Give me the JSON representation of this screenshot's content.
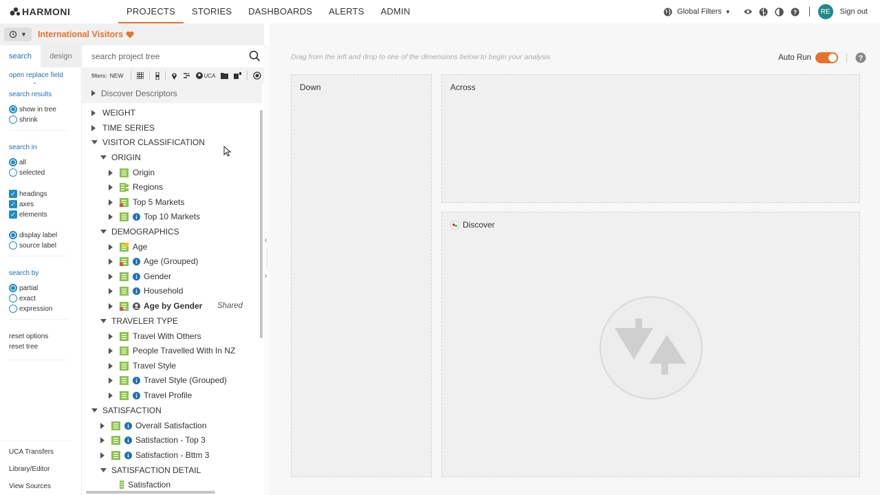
{
  "app": {
    "name": "HARMONI"
  },
  "nav": [
    "PROJECTS",
    "STORIES",
    "DASHBOARDS",
    "ALERTS",
    "ADMIN"
  ],
  "topright": {
    "global_filters": "Global Filters",
    "avatar": "RE",
    "signout": "Sign out"
  },
  "project": {
    "title": "International Visitors"
  },
  "options": {
    "tab_search": "search",
    "tab_design": "design",
    "open_replace": "open replace field",
    "search_results": "search results",
    "show_in_tree": "show in tree",
    "shrink": "shrink",
    "search_in": "search in",
    "all": "all",
    "selected": "selected",
    "headings": "headings",
    "axes": "axes",
    "elements": "elements",
    "display_label": "display label",
    "source_label": "source label",
    "search_by": "search by",
    "partial": "partial",
    "exact": "exact",
    "expression": "expression",
    "reset_options": "reset options",
    "reset_tree": "reset tree",
    "uca_transfers": "UCA Transfers",
    "library_editor": "Library/Editor",
    "view_sources": "View Sources"
  },
  "tree": {
    "search_placeholder": "search project tree",
    "filters_label": "filters:",
    "filters_new": "NEW",
    "filter_uca": "UCA",
    "discover_descriptors": "Discover Descriptors",
    "shared_label": "Shared",
    "rows": [
      {
        "label": "WEIGHT"
      },
      {
        "label": "TIME SERIES"
      },
      {
        "label": "VISITOR CLASSIFICATION"
      },
      {
        "label": "ORIGIN"
      },
      {
        "label": "Origin"
      },
      {
        "label": "Regions"
      },
      {
        "label": "Top 5 Markets"
      },
      {
        "label": "Top 10 Markets"
      },
      {
        "label": "DEMOGRAPHICS"
      },
      {
        "label": "Age"
      },
      {
        "label": "Age (Grouped)"
      },
      {
        "label": "Gender"
      },
      {
        "label": "Household"
      },
      {
        "label": "Age by Gender"
      },
      {
        "label": "TRAVELER TYPE"
      },
      {
        "label": "Travel With Others"
      },
      {
        "label": "People Travelled With In NZ"
      },
      {
        "label": "Travel Style"
      },
      {
        "label": "Travel Style (Grouped)"
      },
      {
        "label": "Travel Profile"
      },
      {
        "label": "SATISFACTION"
      },
      {
        "label": "Overall Satisfaction"
      },
      {
        "label": "Satisfaction - Top 3"
      },
      {
        "label": "Satisfaction - Bttm 3"
      },
      {
        "label": "SATISFACTION DETAIL"
      },
      {
        "label": "Satisfaction"
      }
    ]
  },
  "analysis": {
    "hint": "Drag from the left and drop to one of the dimensions below to begin your analysis",
    "auto_run": "Auto Run",
    "down": "Down",
    "across": "Across",
    "discover": "Discover"
  },
  "colors": {
    "accent": "#e8722a",
    "link": "#1f6fb5",
    "radio": "#1f8ec4",
    "node_green": "#8bc34a",
    "avatar": "#1e8a8a"
  }
}
